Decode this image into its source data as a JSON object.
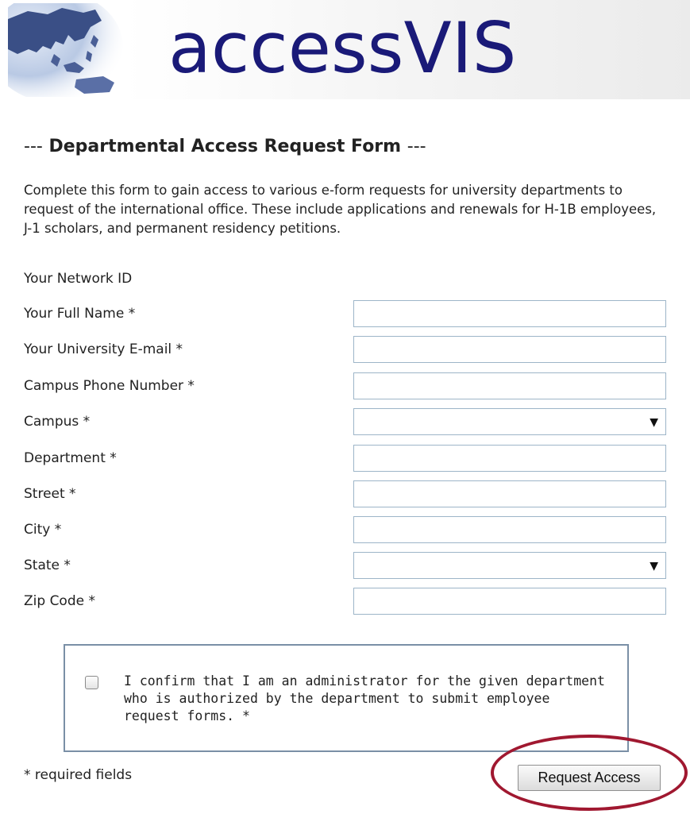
{
  "header": {
    "logo_text": "accessVIS"
  },
  "form": {
    "title": "Departmental Access Request Form",
    "title_dashes": "---",
    "intro": "Complete this form to gain access to various e-form requests for university departments to request of the international office. These include applications and renewals for H-1B employees, J-1 scholars, and permanent residency petitions.",
    "fields": [
      {
        "label": "Your Network ID",
        "type": "text",
        "value": ""
      },
      {
        "label": "Your Full Name *",
        "type": "input",
        "value": ""
      },
      {
        "label": "Your University E-mail *",
        "type": "input",
        "value": ""
      },
      {
        "label": "Campus Phone Number *",
        "type": "input",
        "value": ""
      },
      {
        "label": "Campus *",
        "type": "select",
        "value": ""
      },
      {
        "label": "Department *",
        "type": "input",
        "value": ""
      },
      {
        "label": "Street *",
        "type": "input",
        "value": ""
      },
      {
        "label": "City *",
        "type": "input",
        "value": ""
      },
      {
        "label": "State *",
        "type": "select",
        "value": ""
      },
      {
        "label": "Zip Code *",
        "type": "input",
        "value": ""
      }
    ],
    "dropdown_arrow": "▼",
    "confirm_text": "I confirm that I am an administrator for the given department who is authorized by the department to submit employee request forms. *",
    "confirm_checked": false,
    "required_note": "* required fields",
    "submit_label": "Request Access",
    "highlight_color": "#a01830",
    "brand_color": "#1a1a78",
    "field_border_color": "#9db5c8"
  }
}
